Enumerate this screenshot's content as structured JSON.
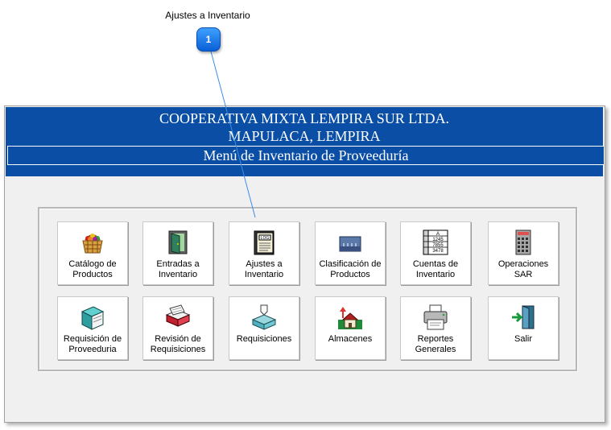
{
  "callout": {
    "label": "Ajustes a Inventario",
    "number": "1"
  },
  "header": {
    "line1": "COOPERATIVA MIXTA LEMPIRA SUR LTDA.",
    "line2": "MAPULACA, LEMPIRA",
    "menu_title": "Menú de Inventario de Proveeduría"
  },
  "buttons": {
    "catalogo": {
      "l1": "Catálogo de",
      "l2": "Productos",
      "icon": "basket-icon"
    },
    "entradas": {
      "l1": "Entradas a",
      "l2": "Inventario",
      "icon": "door-entry-icon"
    },
    "ajustes": {
      "l1": "Ajustes a",
      "l2": "Inventario",
      "icon": "log-book-icon"
    },
    "clasificacion": {
      "l1": "Clasificación de",
      "l2": "Productos",
      "icon": "drawer-icon"
    },
    "cuentas": {
      "l1": "Cuentas de",
      "l2": "Inventario",
      "icon": "ledger-icon"
    },
    "operaciones": {
      "l1": "Operaciones",
      "l2": "SAR",
      "icon": "calculator-icon"
    },
    "requisicion": {
      "l1": "Requisición de",
      "l2": "Proveeduria",
      "icon": "book-icon"
    },
    "revision": {
      "l1": "Revisión de",
      "l2": "Requisiciones",
      "icon": "card-file-icon"
    },
    "requisiciones": {
      "l1": "Requisiciones",
      "icon": "inbox-tray-icon"
    },
    "almacenes": {
      "l1": "Almacenes",
      "icon": "warehouse-icon"
    },
    "reportes": {
      "l1": "Reportes",
      "l2": "Generales",
      "icon": "printer-icon"
    },
    "salir": {
      "l1": "Salir",
      "icon": "exit-door-icon"
    }
  },
  "icon_texts": {
    "log": "LOG",
    "ledger_a": "A",
    "ledger_n1": "1245",
    "ledger_n2": "7855",
    "ledger_n3": "3478"
  },
  "colors": {
    "header_blue": "#0a4ea6",
    "badge_blue": "#1a7ff0",
    "panel_bg": "#f0f0f0"
  }
}
